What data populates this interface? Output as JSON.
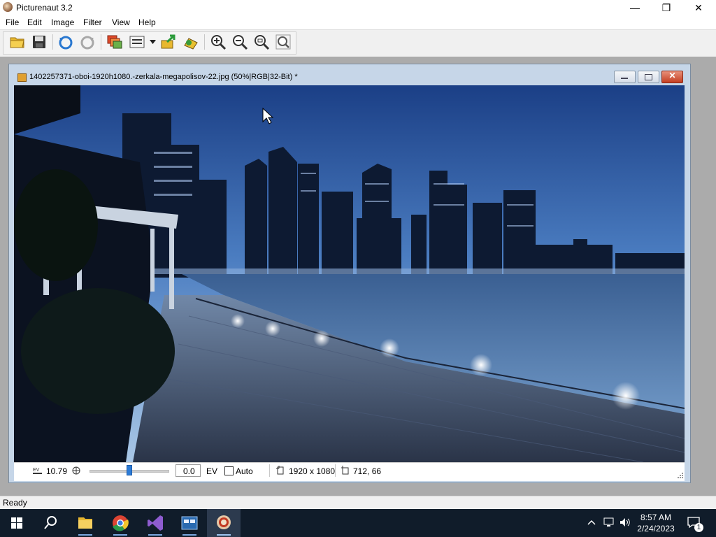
{
  "window": {
    "title": "Picturenaut 3.2",
    "minimize_glyph": "—",
    "maximize_glyph": "❐",
    "close_glyph": "✕"
  },
  "menu": [
    "File",
    "Edit",
    "Image",
    "Filter",
    "View",
    "Help"
  ],
  "toolbar": {
    "icons": [
      "open-folder-icon",
      "save-icon",
      "undo-icon",
      "redo-icon",
      "layers-icon",
      "adjustments-icon",
      "dropdown-arrow-icon",
      "export-icon",
      "tonemap-icon",
      "zoom-in-icon",
      "zoom-out-icon",
      "zoom-fit-icon",
      "zoom-actual-icon"
    ]
  },
  "document": {
    "title": "1402257371-oboi-1920h1080.-zerkala-megapolisov-22.jpg (50%|RGB|32-Bit) *",
    "ev_label": "EV",
    "ev_value": "10.79",
    "ev_field_value": "0.0",
    "ev_unit": "EV",
    "auto_label": "Auto",
    "auto_checked": false,
    "slider_level": 0.5,
    "dimensions": "1920 x 1080",
    "cursor_position": "712, 66"
  },
  "status": {
    "text": "Ready"
  },
  "taskbar": {
    "apps": [
      "windows-start-icon",
      "search-icon",
      "file-explorer-icon",
      "chrome-icon",
      "visual-studio-icon",
      "app-window-icon",
      "picturenaut-icon"
    ],
    "time": "8:57 AM",
    "date": "2/24/2023",
    "notification_count": "1"
  },
  "colors": {
    "accent": "#2c7bd6",
    "taskbar": "#101c2a"
  }
}
